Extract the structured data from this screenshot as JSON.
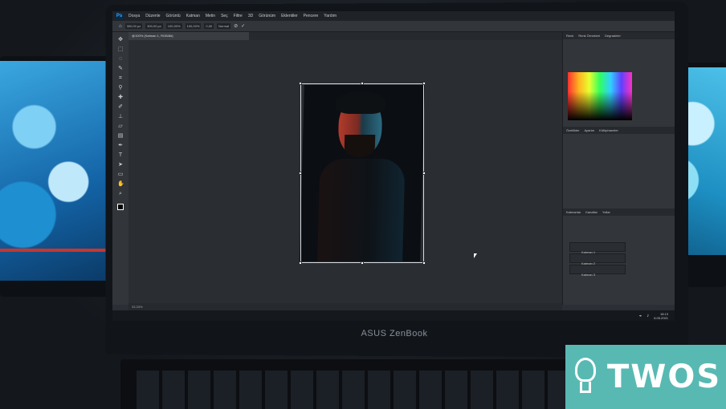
{
  "app": {
    "logo": "Ps",
    "menus": [
      "Dosya",
      "Düzenle",
      "Görüntü",
      "Katman",
      "Metin",
      "Seç",
      "Filtre",
      "3D",
      "Görünüm",
      "Eklentiler",
      "Pencere",
      "Yardım"
    ]
  },
  "options": {
    "width_field": "300,00 px",
    "height_field": "300,00 px",
    "percent_a": "100,00%",
    "percent_b": "100,00%",
    "angle": "0,00",
    "mode": "Normal"
  },
  "document": {
    "tab_label": "@100% (Katman 1, RGB/8#)"
  },
  "panels": {
    "top_tabs": [
      "Renk",
      "Renk Örnekleri",
      "Degradeler"
    ],
    "mid_tabs": [
      "Özellikler",
      "Ayarlar",
      "Kütüphaneler"
    ],
    "layer_tabs": [
      "Katmanlar",
      "Kanallar",
      "Yollar"
    ],
    "layers": [
      "Katman 1",
      "Katman 2",
      "Katman 3"
    ]
  },
  "status": {
    "zoom": "33,33%"
  },
  "taskbar": {
    "time": "18:13",
    "date": "6.05.2021"
  },
  "device": {
    "brand": "ASUS ZenBook"
  },
  "watermark": {
    "text": "TWOS",
    "color": "#58b9b3"
  }
}
